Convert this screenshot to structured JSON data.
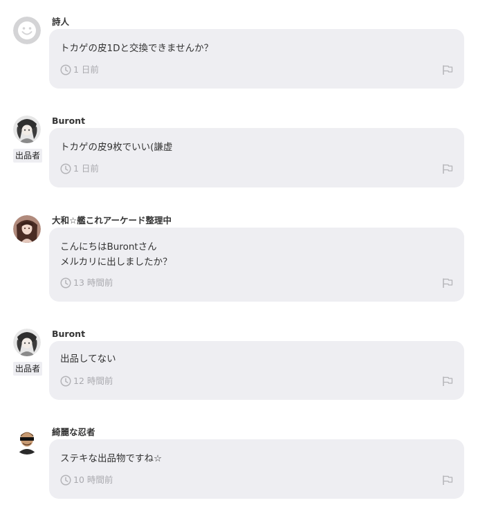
{
  "comments": [
    {
      "username": "詩人",
      "is_seller": false,
      "seller_badge": "",
      "lines": [
        "トカゲの皮1Dと交換できませんか？"
      ],
      "time": "1 日前"
    },
    {
      "username": "Buront",
      "is_seller": true,
      "seller_badge": "出品者",
      "lines": [
        "トカゲの皮9枚でいい(謙虚"
      ],
      "time": "1 日前"
    },
    {
      "username": "大和☆艦これアーケード整理中",
      "is_seller": false,
      "seller_badge": "",
      "lines": [
        "こんにちはBurontさん",
        "メルカリに出しましたか？"
      ],
      "time": "13 時間前"
    },
    {
      "username": "Buront",
      "is_seller": true,
      "seller_badge": "出品者",
      "lines": [
        "出品してない"
      ],
      "time": "12 時間前"
    },
    {
      "username": "綺麗な忍者",
      "is_seller": false,
      "seller_badge": "",
      "lines": [
        "ステキな出品物ですね☆"
      ],
      "time": "10 時間前"
    }
  ],
  "icons": {
    "time": "clock-icon",
    "report": "report-flag-icon",
    "default_avatar": "smiley-avatar-icon"
  },
  "colors": {
    "bubble_bg": "#eeeef2",
    "meta_text": "#a9a9ae",
    "main_text": "#333333"
  }
}
